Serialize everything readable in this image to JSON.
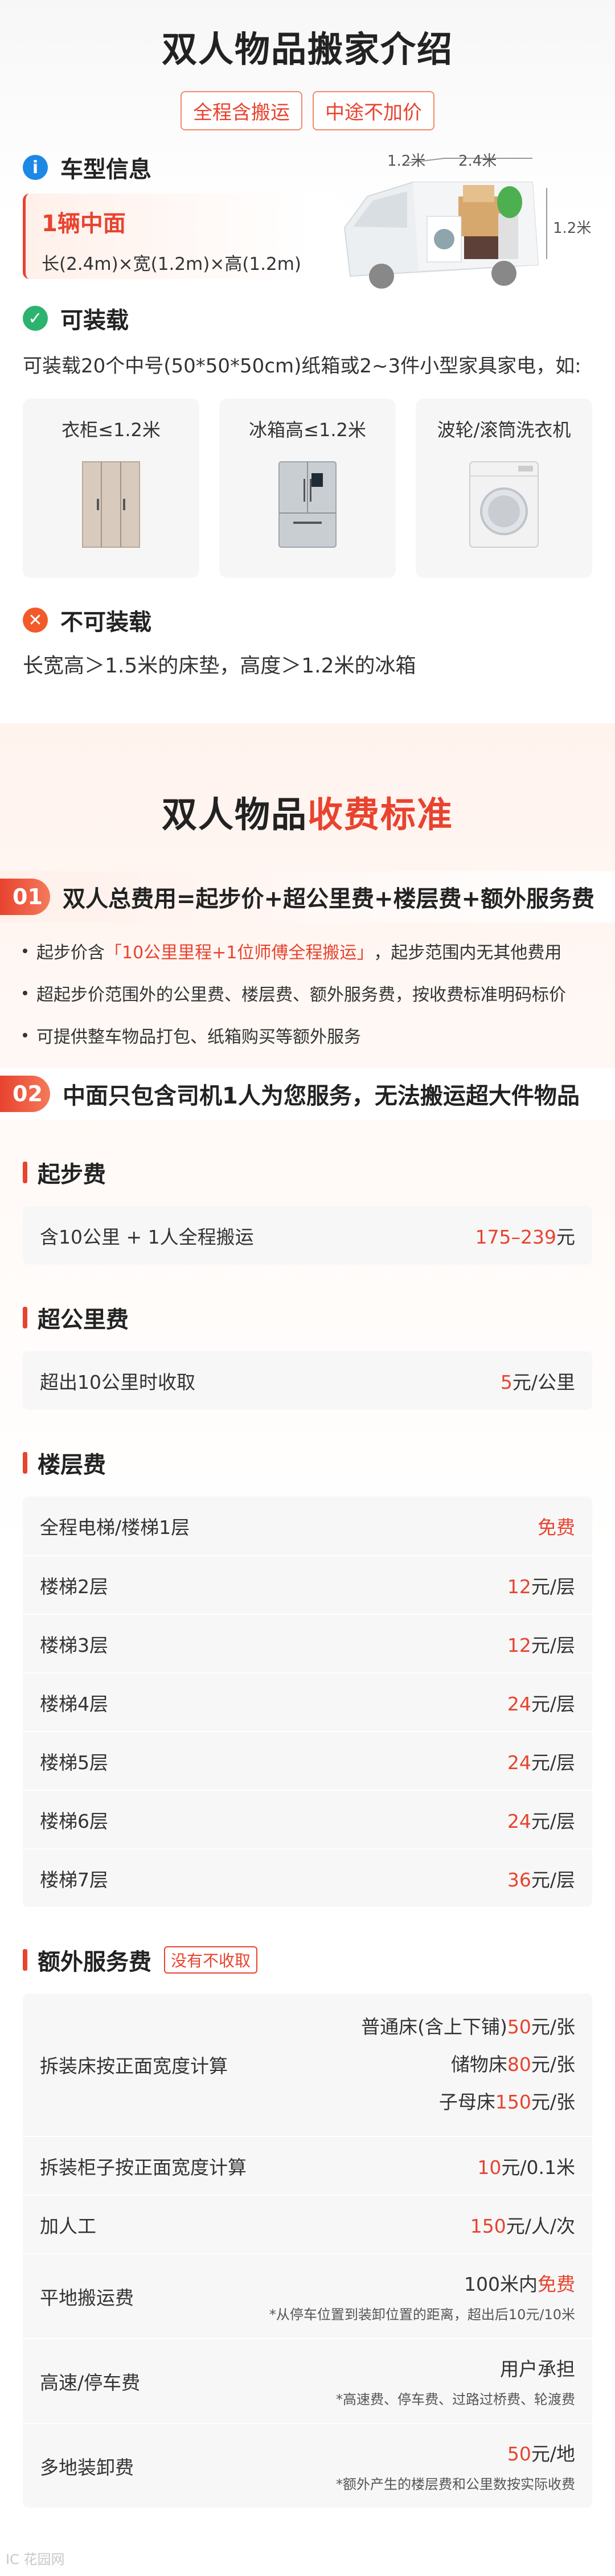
{
  "intro": {
    "title": "双人物品搬家介绍",
    "pills": [
      "全程含搬运",
      "中途不加价"
    ],
    "model": {
      "section_label": "车型信息",
      "name": "1辆中面",
      "dims": "长(2.4m)×宽(1.2m)×高(1.2m)",
      "van_dims": {
        "width": "1.2米",
        "length": "2.4米",
        "height": "1.2米"
      }
    },
    "can_load": {
      "section_label": "可装载",
      "desc": "可装载20个中号(50*50*50cm)纸箱或2~3件小型家具家电，如:",
      "items": [
        {
          "label": "衣柜≤1.2米",
          "icon": "wardrobe-icon"
        },
        {
          "label": "冰箱高≤1.2米",
          "icon": "fridge-icon"
        },
        {
          "label": "波轮/滚筒洗衣机",
          "icon": "washer-icon"
        }
      ]
    },
    "cannot_load": {
      "section_label": "不可装载",
      "desc": "长宽高＞1.5米的床垫，高度＞1.2米的冰箱"
    }
  },
  "fees": {
    "title_prefix": "双人物品",
    "title_highlight": "收费标准",
    "point1": {
      "num": "01",
      "text": "双人总费用=起步价+超公里费+楼层费+额外服务费",
      "bullets": [
        {
          "pre": "起步价含",
          "quote": "「10公里里程+1位师傅全程搬运」",
          "post": "，起步范围内无其他费用"
        },
        {
          "pre": "超起步价范围外的公里费、楼层费、额外服务费，按收费标准明码标价",
          "quote": "",
          "post": ""
        },
        {
          "pre": "可提供整车物品打包、纸箱购买等额外服务",
          "quote": "",
          "post": ""
        }
      ]
    },
    "point2": {
      "num": "02",
      "text": "中面只包含司机1人为您服务，无法搬运超大件物品"
    },
    "base": {
      "title": "起步费",
      "rows": [
        {
          "label": "含10公里 + 1人全程搬运",
          "num": "175–239",
          "unit": "元"
        }
      ]
    },
    "mileage": {
      "title": "超公里费",
      "rows": [
        {
          "label": "超出10公里时收取",
          "num": "5",
          "unit": "元/公里"
        }
      ]
    },
    "floor": {
      "title": "楼层费",
      "rows": [
        {
          "label": "全程电梯/楼梯1层",
          "num": "免费",
          "unit": ""
        },
        {
          "label": "楼梯2层",
          "num": "12",
          "unit": "元/层"
        },
        {
          "label": "楼梯3层",
          "num": "12",
          "unit": "元/层"
        },
        {
          "label": "楼梯4层",
          "num": "24",
          "unit": "元/层"
        },
        {
          "label": "楼梯5层",
          "num": "24",
          "unit": "元/层"
        },
        {
          "label": "楼梯6层",
          "num": "24",
          "unit": "元/层"
        },
        {
          "label": "楼梯7层",
          "num": "36",
          "unit": "元/层"
        }
      ]
    },
    "extra": {
      "title": "额外服务费",
      "tag": "没有不收取",
      "bed": {
        "label": "拆装床按正面宽度计算",
        "lines": [
          {
            "pre": "普通床(含上下铺)",
            "num": "50",
            "unit": "元/张"
          },
          {
            "pre": "储物床",
            "num": "80",
            "unit": "元/张"
          },
          {
            "pre": "子母床",
            "num": "150",
            "unit": "元/张"
          }
        ]
      },
      "cabinet": {
        "label": "拆装柜子按正面宽度计算",
        "num": "10",
        "unit": "元/0.1米"
      },
      "worker": {
        "label": "加人工",
        "num": "150",
        "unit": "元/人/次"
      },
      "ground": {
        "label": "平地搬运费",
        "pre": "100米内",
        "num": "免费",
        "note": "*从停车位置到装卸位置的距离，超出后10元/10米"
      },
      "toll": {
        "label": "高速/停车费",
        "value": "用户承担",
        "note": "*高速费、停车费、过路过桥费、轮渡费"
      },
      "multi": {
        "label": "多地装卸费",
        "num": "50",
        "unit": "元/地",
        "note": "*额外产生的楼层费和公里数按实际收费"
      }
    }
  },
  "watermark": "IC 花园网"
}
